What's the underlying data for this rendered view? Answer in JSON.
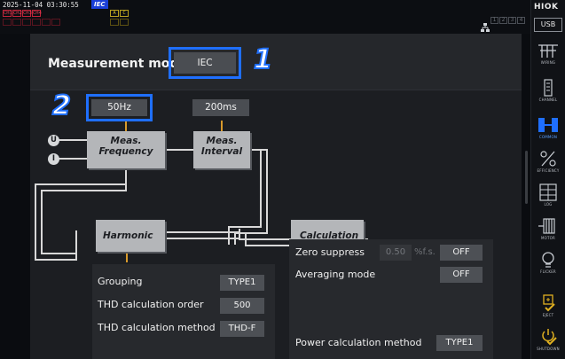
{
  "status_bar": {
    "datetime": "2025-11-04 03:30:55",
    "mode_badge": "IEC",
    "channels_row1": [
      "CH1",
      "CH2",
      "CH3",
      "CH4"
    ],
    "channels_row2": [
      "",
      "",
      "",
      "",
      "",
      ""
    ],
    "yellow_channels": [
      "A",
      "C"
    ],
    "slots": [
      "1",
      "2",
      "3",
      "4"
    ]
  },
  "sidebar": {
    "brand": "HIOK",
    "usb": "USB",
    "items": [
      {
        "label": "WIRING",
        "icon": "wiring-icon"
      },
      {
        "label": "CHANNEL",
        "icon": "channel-icon"
      },
      {
        "label": "COMMON",
        "icon": "common-icon",
        "active": true
      },
      {
        "label": "EFFICIENCY",
        "icon": "efficiency-icon"
      },
      {
        "label": "LOG",
        "icon": "log-icon"
      },
      {
        "label": "MOTOR",
        "icon": "motor-icon"
      },
      {
        "label": "FLICKER",
        "icon": "flicker-icon"
      },
      {
        "label": "EJECT",
        "icon": "eject-icon"
      },
      {
        "label": "SHUTDOWN",
        "icon": "shutdown-icon"
      }
    ],
    "active_color": "#1f6fff"
  },
  "measurement": {
    "label": "Measurement mode",
    "mode_value": "IEC",
    "callout_1": "1",
    "callout_2": "2"
  },
  "diagram": {
    "freq_value": "50Hz",
    "interval_value": "200ms",
    "input_u": "U",
    "input_i": "I",
    "meas_freq_line1": "Meas.",
    "meas_freq_line2": "Frequency",
    "meas_int_line1": "Meas.",
    "meas_int_line2": "Interval",
    "harmonic": "Harmonic",
    "calculation": "Calculation"
  },
  "harmonic_settings": {
    "grouping_label": "Grouping",
    "grouping_value": "TYPE1",
    "thd_order_label": "THD calculation order",
    "thd_order_value": "500",
    "thd_method_label": "THD calculation method",
    "thd_method_value": "THD-F"
  },
  "calculation_settings": {
    "zero_label": "Zero suppress",
    "zero_value": "0.50",
    "zero_unit": "%f.s.",
    "zero_state": "OFF",
    "avg_label": "Averaging mode",
    "avg_value": "OFF",
    "power_label": "Power calculation method",
    "power_value": "TYPE1"
  },
  "colors": {
    "accent": "#1f6fff",
    "node_fill": "#b4b6b9",
    "connector": "#d8d8d8",
    "tick_orange": "#d99a2b"
  }
}
